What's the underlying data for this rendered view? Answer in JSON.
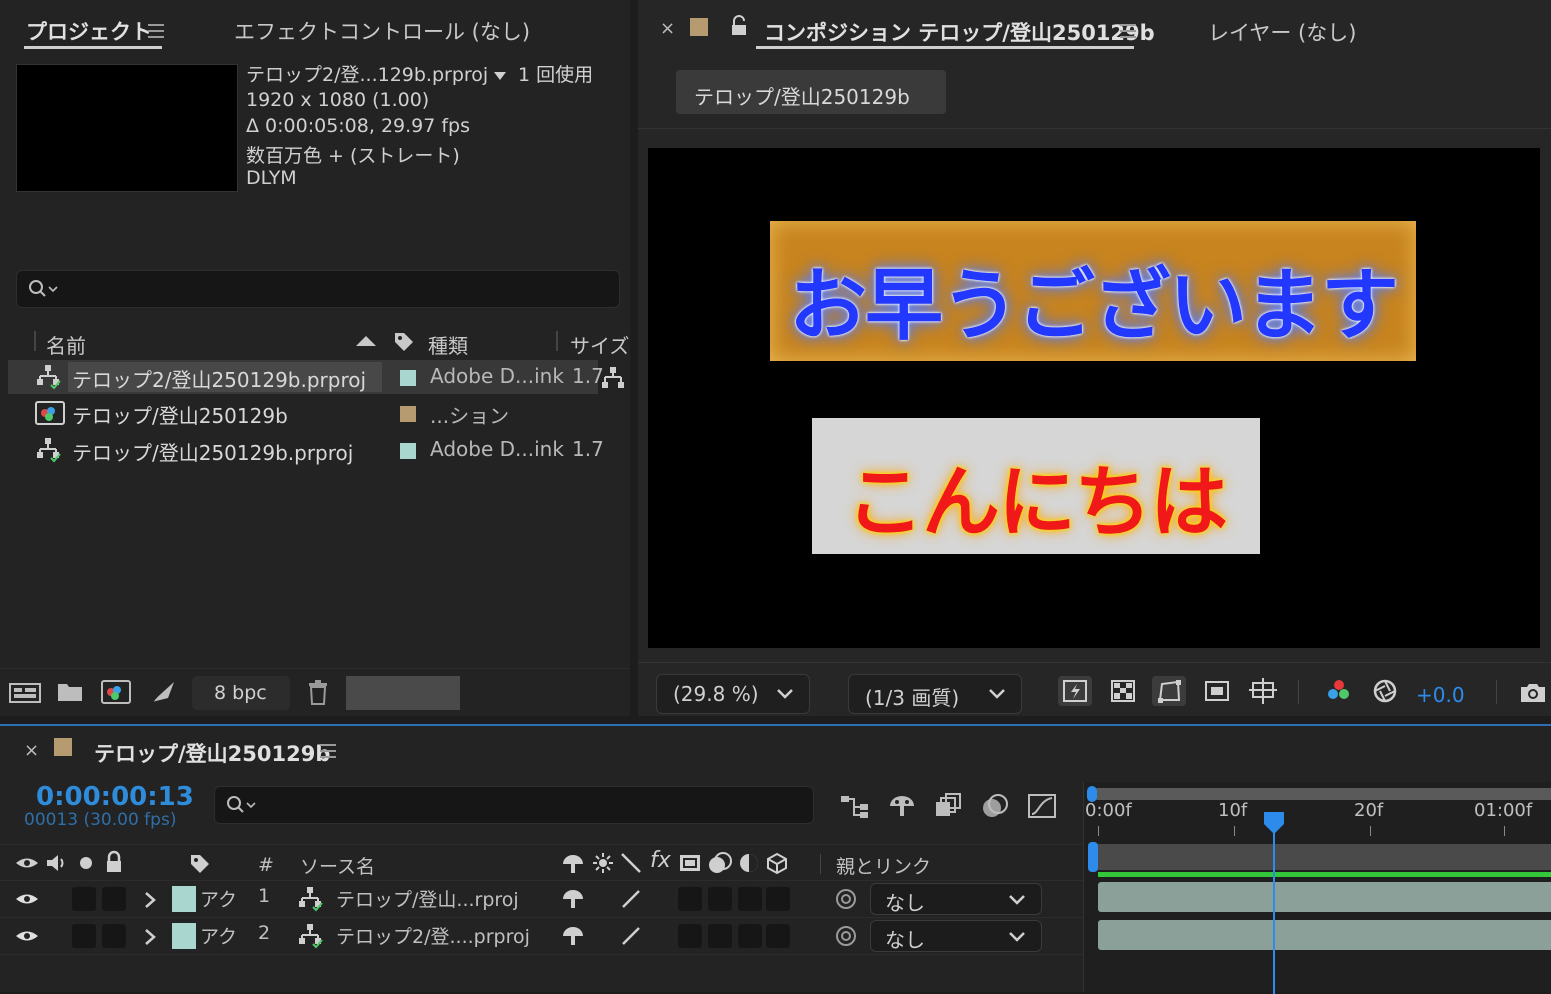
{
  "project_panel": {
    "tab_project": "プロジェクト",
    "tab_effect_controls": "エフェクトコントロール (なし)",
    "selected_name": "テロップ2/登...129b.prproj",
    "usage": "1 回使用",
    "resolution": "1920 x 1080 (1.00)",
    "duration": "Δ 0:00:05:08, 29.97 fps",
    "color_depth": "数百万色 + (ストレート)",
    "codec": "DLYM",
    "columns": {
      "name": "名前",
      "type": "種類",
      "size": "サイズ"
    },
    "items": [
      {
        "name": "テロップ2/登山250129b.prproj",
        "type": "Adobe D...ink",
        "size": "1.7",
        "color": "#a9d6cf",
        "icon": "dynamic-link-icon"
      },
      {
        "name": "テロップ/登山250129b",
        "type": "...ション",
        "size": "",
        "color": "#b79b70",
        "icon": "composition-icon"
      },
      {
        "name": "テロップ/登山250129b.prproj",
        "type": "Adobe D...ink",
        "size": "1.7",
        "color": "#a9d6cf",
        "icon": "dynamic-link-icon"
      }
    ],
    "bpc_label": "8 bpc"
  },
  "composition_panel": {
    "tab_title": "コンポジション テロップ/登山250129b",
    "layer_tab": "レイヤー (なし)",
    "breadcrumb": "テロップ/登山250129b",
    "caption_top": "お早うございます",
    "caption_bottom": "こんにちは",
    "zoom": "(29.8 %)",
    "quality": "(1/3 画質)",
    "exposure": "+0.0"
  },
  "timeline": {
    "comp_name": "テロップ/登山250129b",
    "timecode": "0:00:00:13",
    "frame_info": "00013 (30.00 fps)",
    "headers": {
      "hash": "#",
      "source_name": "ソース名",
      "parent": "親とリンク"
    },
    "ruler": [
      "0:00f",
      "10f",
      "20f",
      "01:00f"
    ],
    "playhead_frame": 13,
    "layers": [
      {
        "label": "アク",
        "number": "1",
        "source": "テロップ/登山...rproj",
        "parent": "なし"
      },
      {
        "label": "アク",
        "number": "2",
        "source": "テロップ2/登....prproj",
        "parent": "なし"
      }
    ]
  },
  "colors": {
    "accent_blue": "#2d8ceb",
    "timecode_blue": "#2f8cdb",
    "work_area_green": "#32c83a"
  }
}
